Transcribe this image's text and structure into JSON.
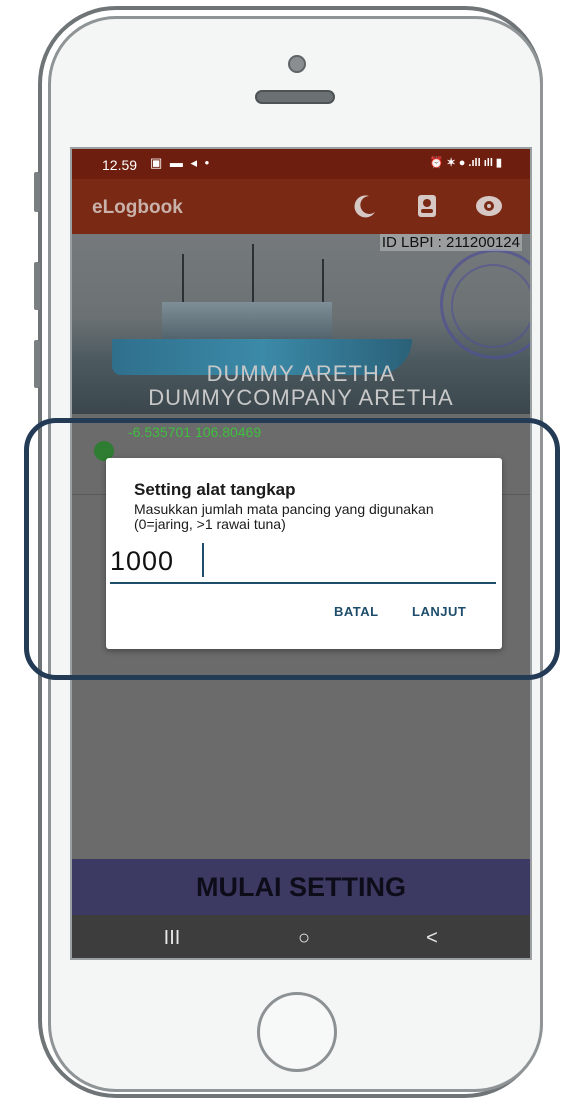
{
  "status_bar": {
    "time": "12.59",
    "left_icons": "▣ ▬ ◂ •",
    "right_icons": "⏰ ✶ ● .ıll ıll ▮"
  },
  "app_bar": {
    "title": "eLogbook",
    "icons": [
      "night-mode-icon",
      "contact-icon",
      "eye-icon"
    ]
  },
  "header": {
    "id_lbpi": "ID LBPI : 211200124",
    "vessel_name": "DUMMY ARETHA",
    "company_name": "DUMMYCOMPANY ARETHA",
    "coordinates": "-6.535701 106.80469"
  },
  "dialog": {
    "title": "Setting alat tangkap",
    "message": "Masukkan jumlah mata pancing yang digunakan (0=jaring, >1 rawai tuna)",
    "input_value": "1000",
    "cancel_label": "BATAL",
    "continue_label": "LANJUT"
  },
  "bottom": {
    "start_label": "MULAI SETTING"
  },
  "nav_bar": {
    "recents": "III",
    "home": "○",
    "back": "<"
  },
  "colors": {
    "app_bar": "#7a2a14",
    "start_button": "#3c3a63",
    "dialog_accent": "#1e4d6b",
    "highlight_frame": "#233b55",
    "coordinates": "#3fbf3f"
  }
}
